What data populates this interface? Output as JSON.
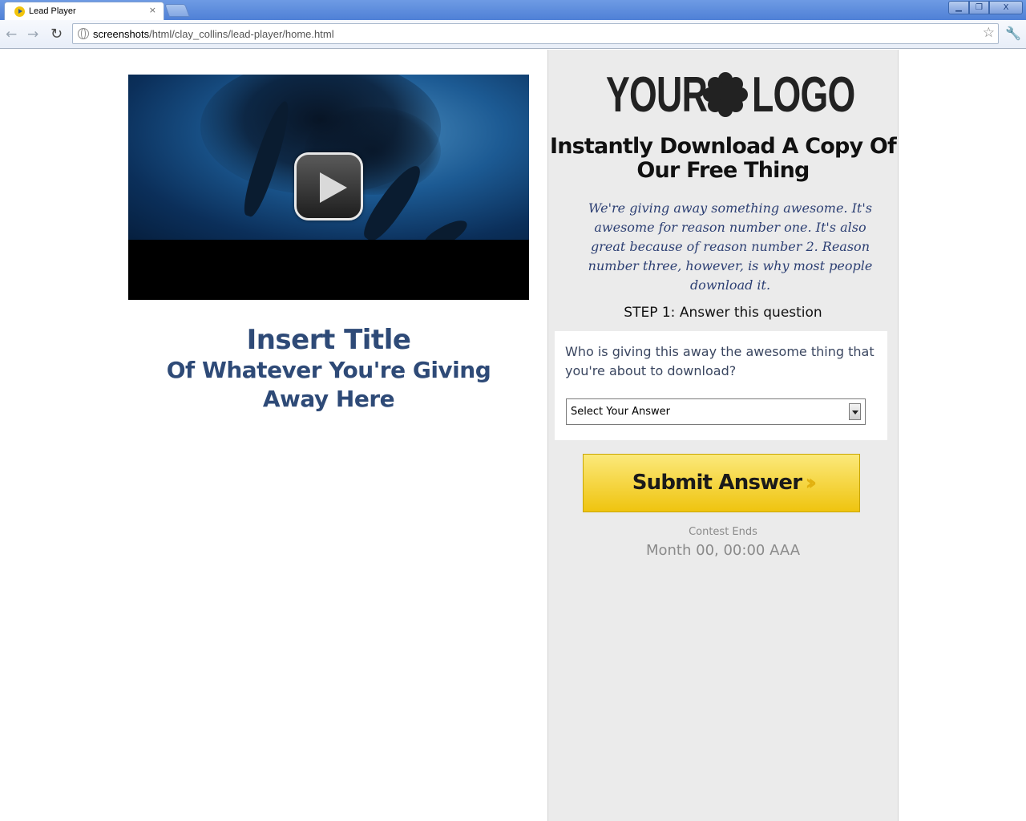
{
  "browser": {
    "tab_title": "Lead Player",
    "tab_close": "×",
    "url_host": "screenshots",
    "url_path": "/html/clay_collins/lead-player/home.html",
    "window_buttons": {
      "minimize": "▁",
      "maximize": "❐",
      "close": "X"
    }
  },
  "video": {
    "play_icon": "play-icon",
    "colors": {
      "water": "#1c5a93",
      "letterbox": "#000000"
    }
  },
  "left": {
    "title_line1": "Insert Title",
    "title_line2": "Of Whatever You're Giving",
    "title_line3": "Away Here",
    "title_color": "#2e4a77"
  },
  "sidebar": {
    "logo_left": "YOUR",
    "logo_right": "LOGO",
    "headline_line1": "Instantly Download A Copy Of",
    "headline_line2": "Our Free Thing",
    "blurb": "We're giving away something awesome. It's awesome for reason number one. It's also great because of reason number 2. Reason number three, however, is why most people download it.",
    "step": "STEP 1: Answer this question",
    "question": "Who is giving this away the awesome thing that you're about to download?",
    "select_value": "Select Your Answer",
    "submit_label": "Submit Answer",
    "submit_icon": "chevrons-icon",
    "contest_label": "Contest Ends",
    "contest_date": "Month 00, 00:00 AAA",
    "colors": {
      "background": "#ebebeb",
      "button": "#f6d84a",
      "blurb": "#2c3f73"
    }
  }
}
